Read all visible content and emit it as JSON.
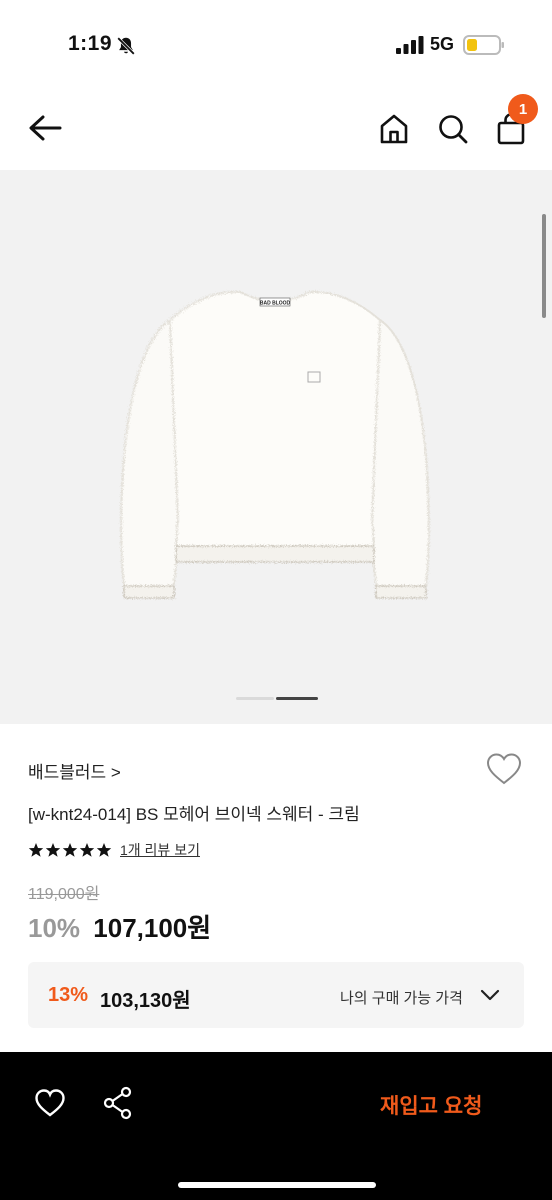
{
  "status_bar": {
    "time": "1:19",
    "network": "5G",
    "icons": [
      "bell-slash-icon",
      "signal-icon",
      "battery-icon"
    ]
  },
  "nav": {
    "back_icon": "arrow-left-icon",
    "home_icon": "home-icon",
    "search_icon": "search-icon",
    "bag_icon": "shopping-bag-icon",
    "bag_badge": "1"
  },
  "gallery": {
    "image": "white-mohair-sweater",
    "image_label": "BAD BLOOD",
    "slide_count": 2,
    "active_slide": 2
  },
  "product": {
    "brand": "배드블러드 >",
    "title": "[w-knt24-014] BS 모헤어 브이넥 스웨터 - 크림",
    "rating_stars": 5,
    "review_link": "1개 리뷰 보기",
    "original_price": "119,000원",
    "discount": "10%",
    "sale_price": "107,100원"
  },
  "member_price": {
    "discount": "13%",
    "price": "103,130원",
    "label": "나의 구매 가능 가격"
  },
  "bottom_bar": {
    "restock_label": "재입고 요청"
  },
  "colors": {
    "accent": "#f05a1b",
    "bottom_bar_bg": "#000000",
    "gallery_bg": "#f2f2f2"
  }
}
